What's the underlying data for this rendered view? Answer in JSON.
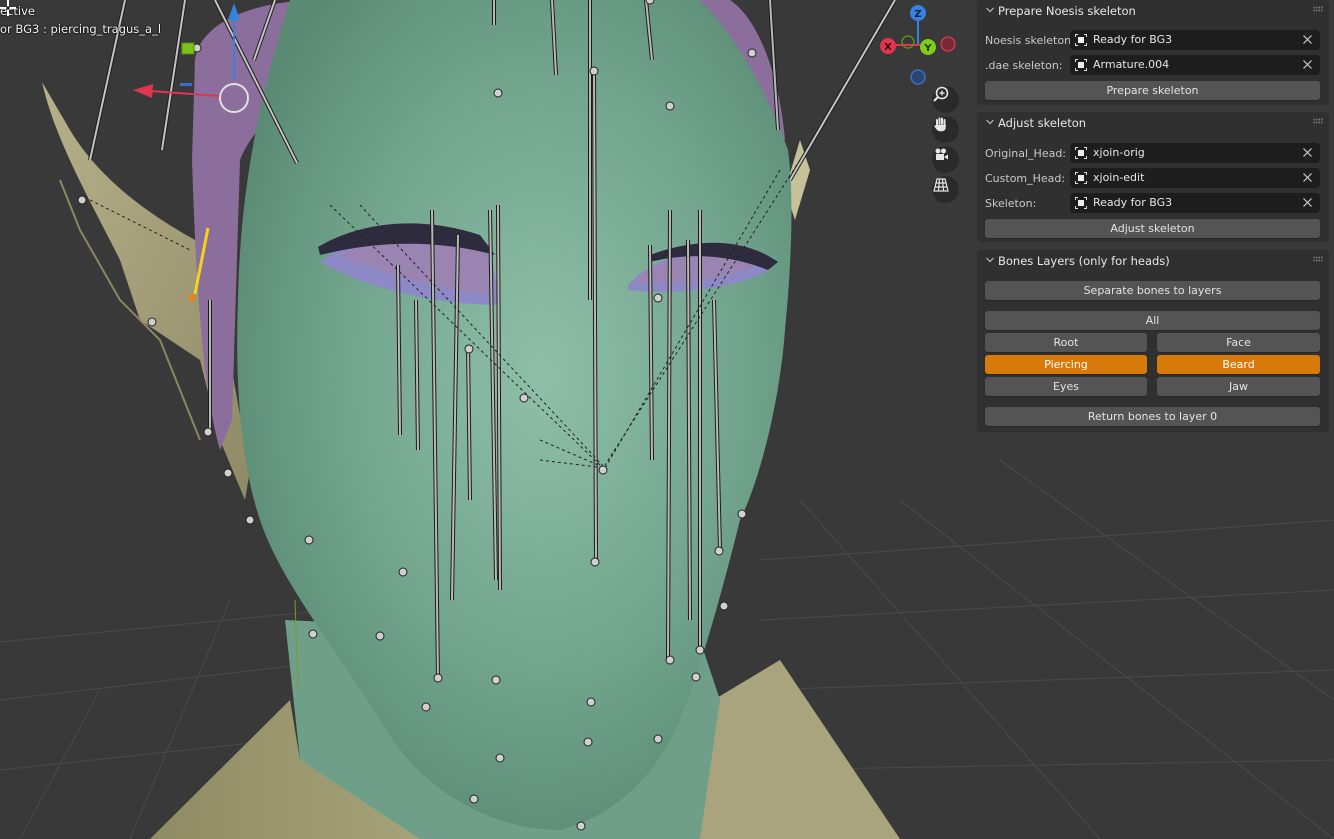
{
  "viewport": {
    "mode_text": "ective",
    "object_text": "or BG3 : piercing_tragus_a_l",
    "gizmo_axes": {
      "x": "X",
      "y": "Y",
      "z": "Z"
    },
    "nav_buttons": [
      {
        "name": "zoom-icon",
        "tooltip": "Zoom"
      },
      {
        "name": "hand-pan-icon",
        "tooltip": "Move"
      },
      {
        "name": "camera-icon",
        "tooltip": "Camera view"
      },
      {
        "name": "grid-perspective-icon",
        "tooltip": "Perspective/Orthographic"
      }
    ],
    "colors": {
      "background": "#393939",
      "skin": "#6fa08a",
      "cap": "#8a6f9a",
      "ear_body": "#a9a47e",
      "eyelid": "#2e2b3e",
      "eye_inner": "#9a84b2",
      "eye_lower": "#8d89c7",
      "axis_x": "#e0344f",
      "axis_y": "#7fcc1a",
      "axis_z": "#3582e0"
    }
  },
  "sidebar": {
    "panels": [
      {
        "title": "Prepare Noesis skeleton",
        "fields": [
          {
            "label": "Noesis skeleton:",
            "value": "Ready for BG3"
          },
          {
            "label": ".dae skeleton:",
            "value": "Armature.004"
          }
        ],
        "button": "Prepare skeleton"
      },
      {
        "title": "Adjust skeleton",
        "fields": [
          {
            "label": "Original_Head:",
            "value": "xjoin-orig"
          },
          {
            "label": "Custom_Head:",
            "value": "xjoin-edit"
          },
          {
            "label": "Skeleton:",
            "value": "Ready for BG3"
          }
        ],
        "button": "Adjust skeleton"
      },
      {
        "title": "Bones Layers (only for heads)",
        "separate_button": "Separate bones to layers",
        "all_button": "All",
        "layer_buttons": [
          {
            "label": "Root",
            "active": false
          },
          {
            "label": "Face",
            "active": false
          },
          {
            "label": "Piercing",
            "active": true
          },
          {
            "label": "Beard",
            "active": true
          },
          {
            "label": "Eyes",
            "active": false
          },
          {
            "label": "Jaw",
            "active": false
          }
        ],
        "return_button": "Return bones to layer 0"
      }
    ],
    "accent_color": "#d87a0a"
  }
}
